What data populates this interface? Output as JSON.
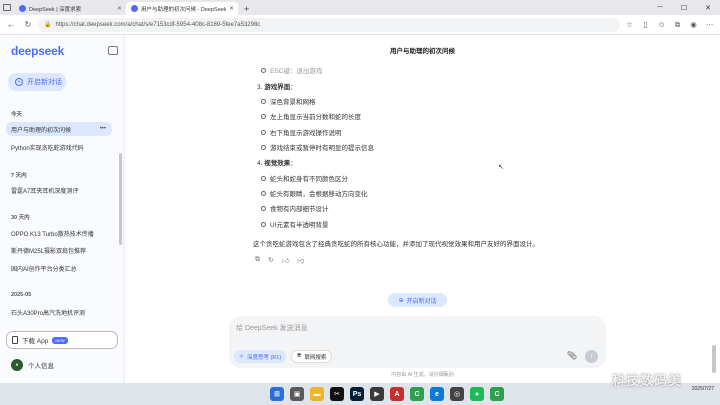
{
  "browser": {
    "tabs": [
      {
        "title": "DeepSeek | 深度求索",
        "active": false
      },
      {
        "title": "用户与助理的初次问候 - DeepSeek",
        "active": true
      }
    ],
    "url": "https://chat.deepseek.com/a/chat/s/e7153cdf-5954-408c-8169-5fee7a53298c"
  },
  "sidebar": {
    "logo": "deepseek",
    "new_chat_label": "开启新对话",
    "sections": [
      {
        "label": "今天",
        "items": [
          "用户与助理的初次问候",
          "Python实现贪吃蛇游戏代码"
        ]
      },
      {
        "label": "7 天内",
        "items": [
          "雷霆A7耳夹耳机深度测评"
        ]
      },
      {
        "label": "30 天内",
        "items": [
          "OPPO K13 Turbo散热技术传播",
          "斯丹德M25L摄影双肩包推荐",
          "国内AI创作平台分类汇总"
        ]
      },
      {
        "label": "2025-05",
        "items": [
          "石头A30Pro高汽洗地机评测"
        ]
      }
    ],
    "download_app_label": "下载 App",
    "new_badge": "NEW",
    "profile_label": "个人信息"
  },
  "conversation": {
    "title": "用户与助理的初次问候",
    "faded_item": "ESC键：退出游戏",
    "groups": [
      {
        "num": "3.",
        "heading": "游戏界面",
        "items": [
          "深色背景和网格",
          "左上角显示当前分数和蛇的长度",
          "右下角显示游戏操作说明",
          "游戏结束或暂停时有明显的提示信息"
        ]
      },
      {
        "num": "4.",
        "heading": "视觉效果",
        "items": [
          "蛇头和蛇身有不同颜色区分",
          "蛇头有眼睛，会根据移动方向变化",
          "食物有内部细节设计",
          "UI元素有半透明背景"
        ]
      }
    ],
    "summary": "这个贪吃蛇游戏包含了经典贪吃蛇的所有核心功能，并添加了现代视觉效果和用户友好的界面设计。"
  },
  "composer": {
    "new_topic_label": "开启新对话",
    "placeholder": "给 DeepSeek 发送消息",
    "deep_think_label": "深度思考 (R1)",
    "web_search_label": "联网搜索"
  },
  "disclaimer": "内容由 AI 生成，请仔细甄别",
  "taskbar": {
    "date": "2025/7/27"
  },
  "watermark": "科技数码美"
}
